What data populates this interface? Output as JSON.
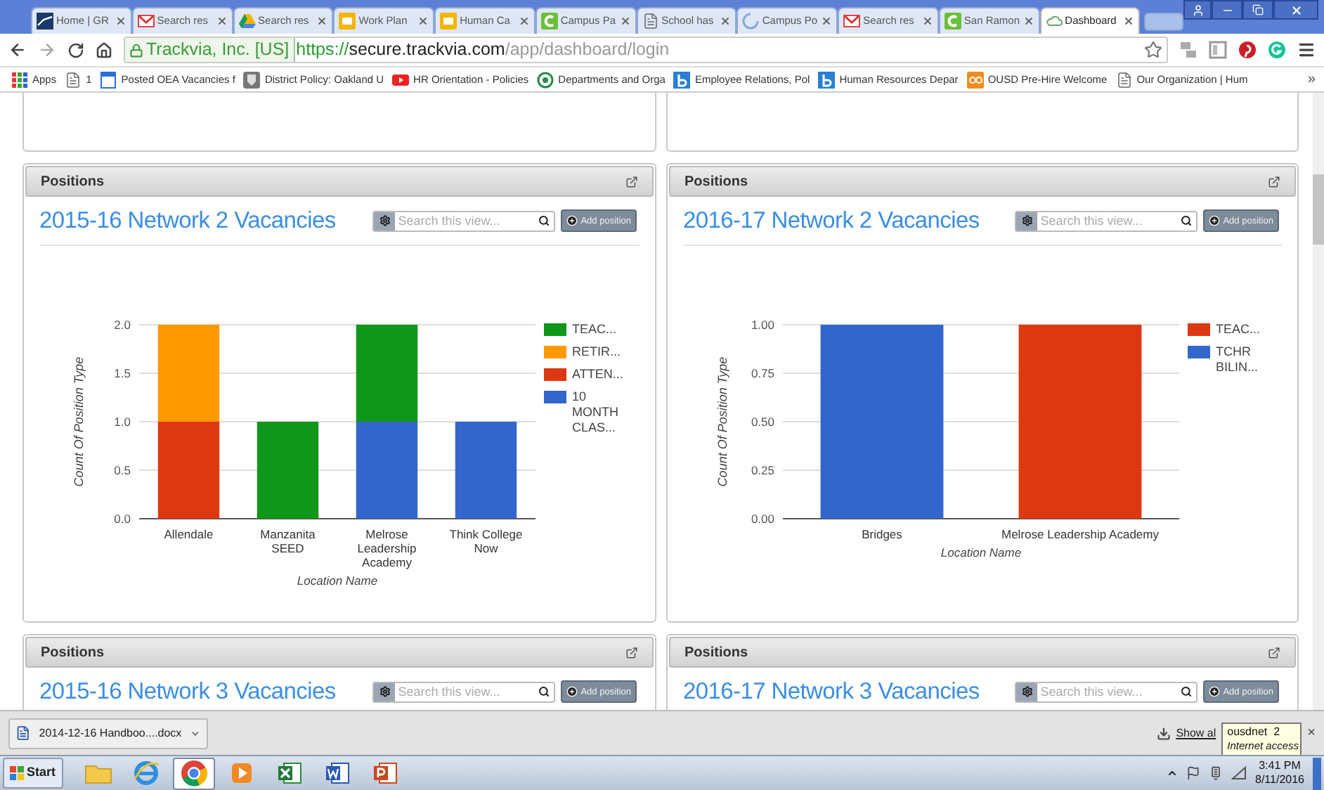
{
  "browser": {
    "tabs": [
      {
        "title": "Home | GR",
        "kind": "chart",
        "selected": false
      },
      {
        "title": "Search res",
        "kind": "mail",
        "selected": false
      },
      {
        "title": "Search res",
        "kind": "drive",
        "selected": false
      },
      {
        "title": "Work Plan",
        "kind": "slides",
        "selected": false
      },
      {
        "title": "Human Ca",
        "kind": "slides",
        "selected": false
      },
      {
        "title": "Campus Pa",
        "kind": "campus",
        "selected": false
      },
      {
        "title": "School has",
        "kind": "page",
        "selected": false
      },
      {
        "title": "Campus Po",
        "kind": "loading",
        "selected": false
      },
      {
        "title": "Search res",
        "kind": "mail",
        "selected": false
      },
      {
        "title": "San Ramon",
        "kind": "campus",
        "selected": false
      },
      {
        "title": "Dashboard",
        "kind": "cloud",
        "selected": true
      }
    ],
    "address": {
      "identity": "Trackvia, Inc. [US]",
      "scheme": "https://",
      "host": "secure.trackvia.com",
      "path": "/app/dashboard/login"
    },
    "bookmarks": [
      {
        "label": "Apps",
        "kind": "apps"
      },
      {
        "label": "1",
        "kind": "page"
      },
      {
        "label": "Posted OEA Vacancies f",
        "kind": "sheet"
      },
      {
        "label": "District Policy: Oakland U",
        "kind": "shield"
      },
      {
        "label": "HR Orientation - Policies",
        "kind": "video"
      },
      {
        "label": "Departments and Orga",
        "kind": "seal"
      },
      {
        "label": "Employee Relations, Pol",
        "kind": "b"
      },
      {
        "label": "Human Resources Depar",
        "kind": "b"
      },
      {
        "label": "OUSD Pre-Hire Welcome",
        "kind": "go"
      },
      {
        "label": "Our Organization | Hum",
        "kind": "page"
      }
    ],
    "bookmarks_more": "»"
  },
  "panels": [
    {
      "header": "Positions",
      "title": "2015-16 Network 2 Vacancies",
      "search": {
        "placeholder": "Search this view..."
      },
      "add_button": "Add position",
      "chart_data": {
        "type": "bar",
        "stacked": true,
        "grid": true,
        "legend": true,
        "xlabel": "Location Name",
        "ylabel": "Count Of Position Type",
        "categories": [
          "Allendale",
          "Manzanita SEED",
          "Melrose Leadership Academy",
          "Think College Now"
        ],
        "ylim": [
          0,
          2
        ],
        "yticks": [
          {
            "value": 0,
            "label": "0.0"
          },
          {
            "value": 0.5,
            "label": "0.5"
          },
          {
            "value": 1,
            "label": "1.0"
          },
          {
            "value": 1.5,
            "label": "1.5"
          },
          {
            "value": 2,
            "label": "2.0"
          }
        ],
        "series": [
          {
            "name": "TEAC...",
            "color": "#109618",
            "values": [
              0,
              1,
              1,
              0
            ]
          },
          {
            "name": "RETIR...",
            "color": "#ff9900",
            "values": [
              1,
              0,
              0,
              0
            ]
          },
          {
            "name": "ATTEN...",
            "color": "#dc3912",
            "values": [
              1,
              0,
              0,
              0
            ]
          },
          {
            "name": "10 MONTH CLAS...",
            "color": "#3366cc",
            "values": [
              0,
              0,
              1,
              1
            ]
          }
        ]
      }
    },
    {
      "header": "Positions",
      "title": "2016-17 Network 2 Vacancies",
      "search": {
        "placeholder": "Search this view..."
      },
      "add_button": "Add position",
      "chart_data": {
        "type": "bar",
        "stacked": true,
        "grid": true,
        "legend": true,
        "xlabel": "Location Name",
        "ylabel": "Count Of Position Type",
        "categories": [
          "Bridges",
          "Melrose Leadership Academy"
        ],
        "ylim": [
          0,
          1
        ],
        "yticks": [
          {
            "value": 0,
            "label": "0.00"
          },
          {
            "value": 0.25,
            "label": "0.25"
          },
          {
            "value": 0.5,
            "label": "0.50"
          },
          {
            "value": 0.75,
            "label": "0.75"
          },
          {
            "value": 1,
            "label": "1.00"
          }
        ],
        "series": [
          {
            "name": "TEAC...",
            "color": "#dc3912",
            "values": [
              0,
              1
            ]
          },
          {
            "name": "TCHR BILIN...",
            "color": "#3366cc",
            "values": [
              1,
              0
            ]
          }
        ]
      }
    },
    {
      "header": "Positions",
      "title": "2015-16 Network 3 Vacancies",
      "search": {
        "placeholder": "Search this view..."
      },
      "add_button": "Add position"
    },
    {
      "header": "Positions",
      "title": "2016-17 Network 3 Vacancies",
      "search": {
        "placeholder": "Search this view..."
      },
      "add_button": "Add position"
    }
  ],
  "download_bar": {
    "file": "2014-12-16 Handboo....docx",
    "show_all": "Show al",
    "close": "×"
  },
  "tooltip": {
    "title": "ousdnet  2",
    "subtitle": "Internet access"
  },
  "taskbar": {
    "start": "Start",
    "apps": [
      {
        "kind": "folder",
        "selected": false
      },
      {
        "kind": "ie",
        "selected": false
      },
      {
        "kind": "chrome",
        "selected": true
      },
      {
        "kind": "media",
        "selected": false
      },
      {
        "kind": "excel",
        "selected": false
      },
      {
        "kind": "word",
        "selected": false
      },
      {
        "kind": "powerpoint",
        "selected": false
      }
    ],
    "time": "3:41 PM",
    "date": "8/11/2016"
  }
}
